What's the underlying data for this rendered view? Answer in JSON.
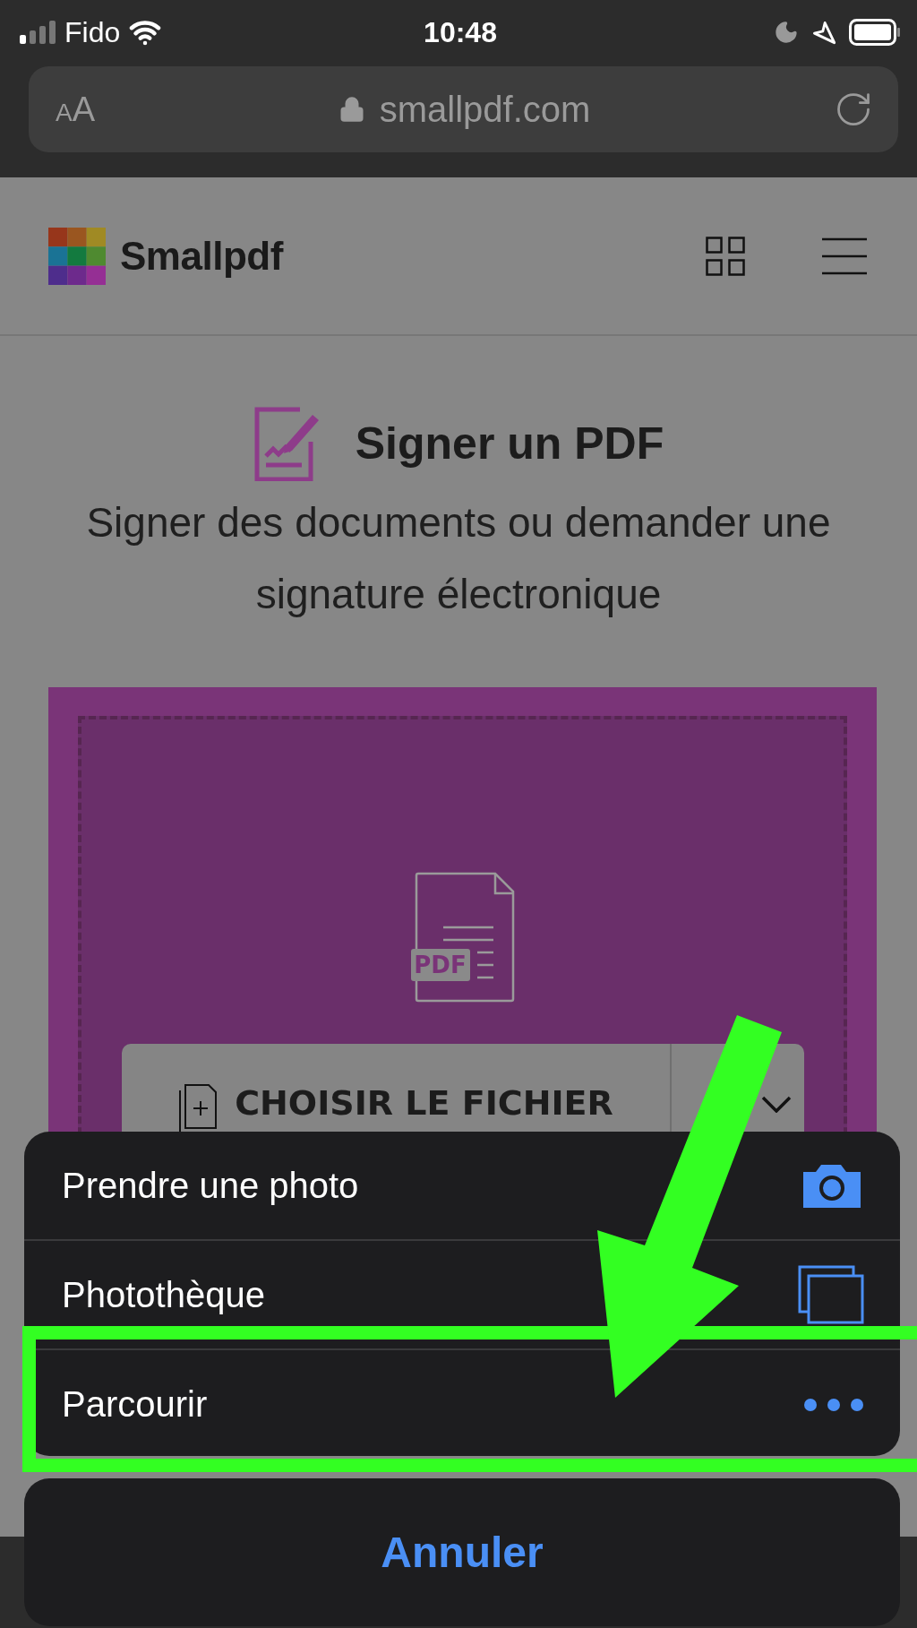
{
  "status_bar": {
    "carrier": "Fido",
    "time": "10:48"
  },
  "address_bar": {
    "text_size_button": "AA",
    "url": "smallpdf.com"
  },
  "header": {
    "logo": "Smallpdf"
  },
  "tool": {
    "title": "Signer un PDF",
    "subtitle": "Signer des documents ou demander une signature électronique"
  },
  "upload": {
    "file_badge": "PDF",
    "button": "CHOISIR LE FICHIER"
  },
  "action_sheet": {
    "items": [
      {
        "label": "Prendre une photo",
        "kind": "camera",
        "highlighted": false
      },
      {
        "label": "Photothèque",
        "kind": "photos",
        "highlighted": false
      },
      {
        "label": "Parcourir",
        "kind": "more",
        "highlighted": true
      }
    ],
    "cancel": "Annuler"
  }
}
